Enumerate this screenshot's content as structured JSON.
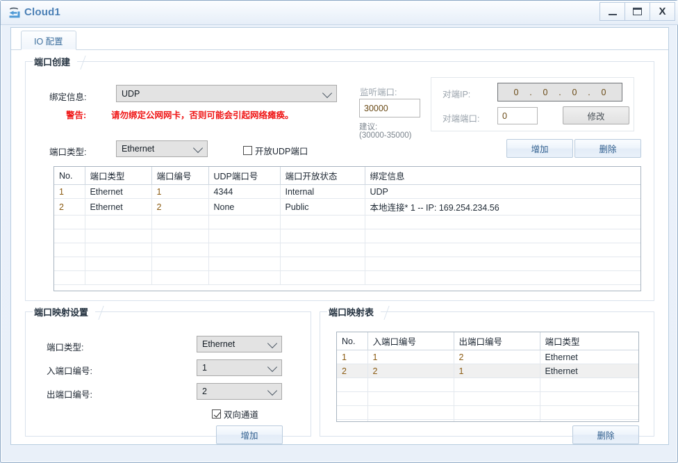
{
  "window": {
    "title": "Cloud1",
    "icon": "cloud-device-icon",
    "buttons": {
      "minimize": "minimize-icon",
      "maximize": "maximize-icon",
      "close": "X"
    }
  },
  "tabs": [
    {
      "label": "IO 配置",
      "active": true
    }
  ],
  "port_create": {
    "title": "端口创建",
    "bind_info_label": "绑定信息:",
    "bind_info_value": "UDP",
    "warning_label": "警告:",
    "warning_text": "请勿绑定公网网卡，否则可能会引起网络瘫痪。",
    "port_type_label": "端口类型:",
    "port_type_value": "Ethernet",
    "open_udp_checkbox": "开放UDP端口",
    "open_udp_checked": false,
    "listen_port_label": "监听端口:",
    "listen_port_value": "30000",
    "suggest_label": "建议:",
    "suggest_range": "(30000-35000)",
    "peer_ip_label": "对端IP:",
    "peer_ip_segments": [
      "0",
      "0",
      "0",
      "0"
    ],
    "peer_port_label": "对端端口:",
    "peer_port_value": "0",
    "modify_button": "修改",
    "add_button": "增加",
    "delete_button": "删除",
    "table": {
      "columns": [
        "No.",
        "端口类型",
        "端口编号",
        "UDP端口号",
        "端口开放状态",
        "绑定信息"
      ],
      "rows": [
        [
          "1",
          "Ethernet",
          "1",
          "4344",
          "Internal",
          "UDP"
        ],
        [
          "2",
          "Ethernet",
          "2",
          "None",
          "Public",
          "本地连接* 1 -- IP: 169.254.234.56"
        ]
      ],
      "empty_rows": 5
    }
  },
  "port_map_settings": {
    "title": "端口映射设置",
    "port_type_label": "端口类型:",
    "port_type_value": "Ethernet",
    "in_port_label": "入端口编号:",
    "in_port_value": "1",
    "out_port_label": "出端口编号:",
    "out_port_value": "2",
    "bidirectional_checkbox": "双向通道",
    "bidirectional_checked": true,
    "add_button": "增加"
  },
  "port_map_table": {
    "title": "端口映射表",
    "columns": [
      "No.",
      "入端口编号",
      "出端口编号",
      "端口类型"
    ],
    "rows": [
      {
        "cells": [
          "1",
          "1",
          "2",
          "Ethernet"
        ],
        "selected": false
      },
      {
        "cells": [
          "2",
          "2",
          "1",
          "Ethernet"
        ],
        "selected": true
      }
    ],
    "empty_rows": 4,
    "delete_button": "删除"
  },
  "colors": {
    "title_text": "#4a7fb5",
    "warning": "#ef1414",
    "button_text": "#2f5e8e",
    "number_cell": "#8a5a10"
  }
}
